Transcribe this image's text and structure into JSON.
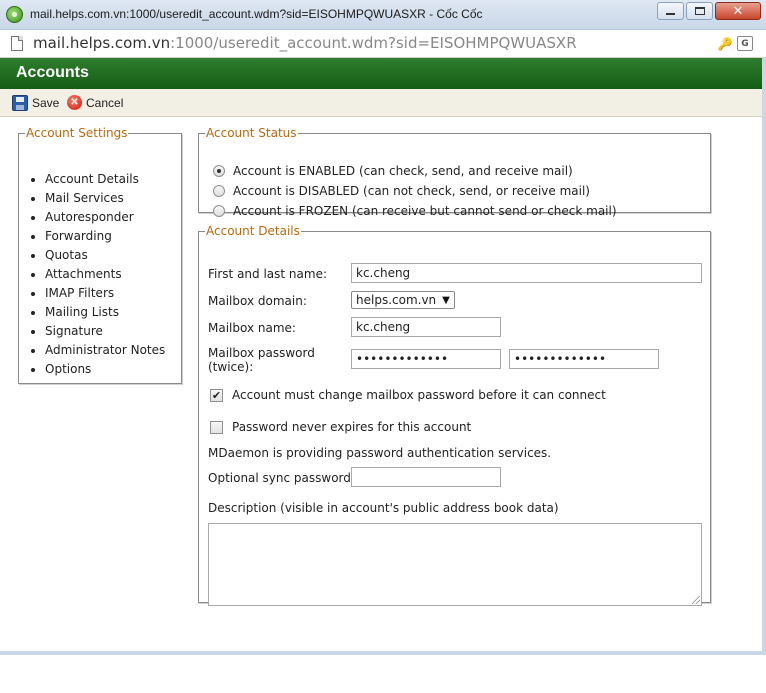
{
  "window": {
    "title": "mail.helps.com.vn:1000/useredit_account.wdm?sid=EISOHMPQWUASXR - Cốc Cốc",
    "min_icon": "minimize-icon",
    "max_icon": "maximize-icon",
    "close_glyph": "✕"
  },
  "address": {
    "host": "mail.helps.com.vn",
    "rest": ":1000/useredit_account.wdm?sid=EISOHMPQWUASXR",
    "key_glyph": "🔑",
    "translate_glyph": "G"
  },
  "header": {
    "title": "Accounts",
    "color": "#1f6e1f"
  },
  "toolbar": {
    "save_label": "Save",
    "cancel_label": "Cancel",
    "cancel_glyph": "✕"
  },
  "settings": {
    "legend": "Account Settings",
    "items": [
      "Account Details",
      "Mail Services",
      "Autoresponder",
      "Forwarding",
      "Quotas",
      "Attachments",
      "IMAP Filters",
      "Mailing Lists",
      "Signature",
      "Administrator Notes",
      "Options"
    ]
  },
  "status": {
    "legend": "Account Status",
    "options": [
      {
        "label": "Account is ENABLED (can check, send, and receive mail)",
        "checked": true
      },
      {
        "label": "Account is DISABLED (can not check, send, or receive mail)",
        "checked": false
      },
      {
        "label": "Account is FROZEN (can receive but cannot send or check mail)",
        "checked": false
      }
    ]
  },
  "details": {
    "legend": "Account Details",
    "name_label": "First and last name:",
    "name_value": "kc.cheng",
    "domain_label": "Mailbox domain:",
    "domain_value": "helps.com.vn",
    "mailbox_label": "Mailbox name:",
    "mailbox_value": "kc.cheng",
    "password_label_1": "Mailbox password",
    "password_label_2": "(twice):",
    "password_1": "•••••••••••••",
    "password_2": "•••••••••••••",
    "must_change_label": "Account must change mailbox password before it can connect",
    "must_change_checked": true,
    "never_expires_label": "Password never expires for this account",
    "never_expires_checked": false,
    "auth_note": "MDaemon is providing password authentication services.",
    "sync_label": "Optional sync password:",
    "sync_value": "",
    "description_label": "Description (visible in account's public address book data)",
    "description_value": ""
  }
}
